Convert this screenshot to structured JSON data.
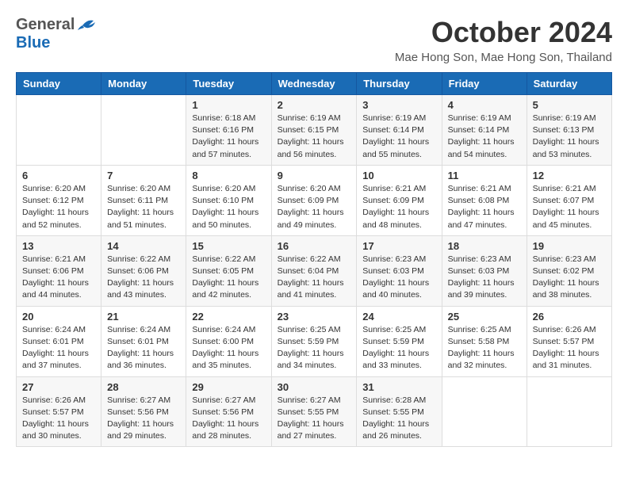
{
  "header": {
    "logo": {
      "general": "General",
      "blue": "Blue",
      "tagline": "GeneralBlue"
    },
    "month": "October 2024",
    "location": "Mae Hong Son, Mae Hong Son, Thailand"
  },
  "weekdays": [
    "Sunday",
    "Monday",
    "Tuesday",
    "Wednesday",
    "Thursday",
    "Friday",
    "Saturday"
  ],
  "weeks": [
    [
      {
        "day": "",
        "info": ""
      },
      {
        "day": "",
        "info": ""
      },
      {
        "day": "1",
        "info": "Sunrise: 6:18 AM\nSunset: 6:16 PM\nDaylight: 11 hours and 57 minutes."
      },
      {
        "day": "2",
        "info": "Sunrise: 6:19 AM\nSunset: 6:15 PM\nDaylight: 11 hours and 56 minutes."
      },
      {
        "day": "3",
        "info": "Sunrise: 6:19 AM\nSunset: 6:14 PM\nDaylight: 11 hours and 55 minutes."
      },
      {
        "day": "4",
        "info": "Sunrise: 6:19 AM\nSunset: 6:14 PM\nDaylight: 11 hours and 54 minutes."
      },
      {
        "day": "5",
        "info": "Sunrise: 6:19 AM\nSunset: 6:13 PM\nDaylight: 11 hours and 53 minutes."
      }
    ],
    [
      {
        "day": "6",
        "info": "Sunrise: 6:20 AM\nSunset: 6:12 PM\nDaylight: 11 hours and 52 minutes."
      },
      {
        "day": "7",
        "info": "Sunrise: 6:20 AM\nSunset: 6:11 PM\nDaylight: 11 hours and 51 minutes."
      },
      {
        "day": "8",
        "info": "Sunrise: 6:20 AM\nSunset: 6:10 PM\nDaylight: 11 hours and 50 minutes."
      },
      {
        "day": "9",
        "info": "Sunrise: 6:20 AM\nSunset: 6:09 PM\nDaylight: 11 hours and 49 minutes."
      },
      {
        "day": "10",
        "info": "Sunrise: 6:21 AM\nSunset: 6:09 PM\nDaylight: 11 hours and 48 minutes."
      },
      {
        "day": "11",
        "info": "Sunrise: 6:21 AM\nSunset: 6:08 PM\nDaylight: 11 hours and 47 minutes."
      },
      {
        "day": "12",
        "info": "Sunrise: 6:21 AM\nSunset: 6:07 PM\nDaylight: 11 hours and 45 minutes."
      }
    ],
    [
      {
        "day": "13",
        "info": "Sunrise: 6:21 AM\nSunset: 6:06 PM\nDaylight: 11 hours and 44 minutes."
      },
      {
        "day": "14",
        "info": "Sunrise: 6:22 AM\nSunset: 6:06 PM\nDaylight: 11 hours and 43 minutes."
      },
      {
        "day": "15",
        "info": "Sunrise: 6:22 AM\nSunset: 6:05 PM\nDaylight: 11 hours and 42 minutes."
      },
      {
        "day": "16",
        "info": "Sunrise: 6:22 AM\nSunset: 6:04 PM\nDaylight: 11 hours and 41 minutes."
      },
      {
        "day": "17",
        "info": "Sunrise: 6:23 AM\nSunset: 6:03 PM\nDaylight: 11 hours and 40 minutes."
      },
      {
        "day": "18",
        "info": "Sunrise: 6:23 AM\nSunset: 6:03 PM\nDaylight: 11 hours and 39 minutes."
      },
      {
        "day": "19",
        "info": "Sunrise: 6:23 AM\nSunset: 6:02 PM\nDaylight: 11 hours and 38 minutes."
      }
    ],
    [
      {
        "day": "20",
        "info": "Sunrise: 6:24 AM\nSunset: 6:01 PM\nDaylight: 11 hours and 37 minutes."
      },
      {
        "day": "21",
        "info": "Sunrise: 6:24 AM\nSunset: 6:01 PM\nDaylight: 11 hours and 36 minutes."
      },
      {
        "day": "22",
        "info": "Sunrise: 6:24 AM\nSunset: 6:00 PM\nDaylight: 11 hours and 35 minutes."
      },
      {
        "day": "23",
        "info": "Sunrise: 6:25 AM\nSunset: 5:59 PM\nDaylight: 11 hours and 34 minutes."
      },
      {
        "day": "24",
        "info": "Sunrise: 6:25 AM\nSunset: 5:59 PM\nDaylight: 11 hours and 33 minutes."
      },
      {
        "day": "25",
        "info": "Sunrise: 6:25 AM\nSunset: 5:58 PM\nDaylight: 11 hours and 32 minutes."
      },
      {
        "day": "26",
        "info": "Sunrise: 6:26 AM\nSunset: 5:57 PM\nDaylight: 11 hours and 31 minutes."
      }
    ],
    [
      {
        "day": "27",
        "info": "Sunrise: 6:26 AM\nSunset: 5:57 PM\nDaylight: 11 hours and 30 minutes."
      },
      {
        "day": "28",
        "info": "Sunrise: 6:27 AM\nSunset: 5:56 PM\nDaylight: 11 hours and 29 minutes."
      },
      {
        "day": "29",
        "info": "Sunrise: 6:27 AM\nSunset: 5:56 PM\nDaylight: 11 hours and 28 minutes."
      },
      {
        "day": "30",
        "info": "Sunrise: 6:27 AM\nSunset: 5:55 PM\nDaylight: 11 hours and 27 minutes."
      },
      {
        "day": "31",
        "info": "Sunrise: 6:28 AM\nSunset: 5:55 PM\nDaylight: 11 hours and 26 minutes."
      },
      {
        "day": "",
        "info": ""
      },
      {
        "day": "",
        "info": ""
      }
    ]
  ]
}
